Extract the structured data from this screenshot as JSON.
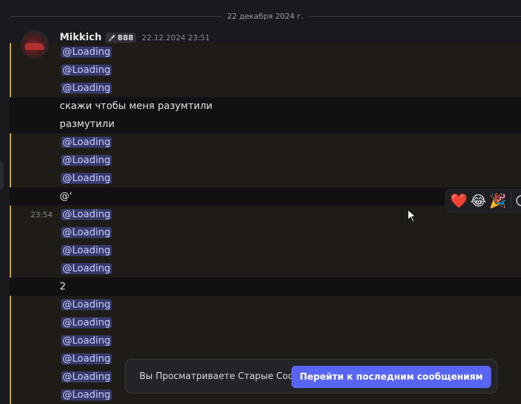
{
  "divider": {
    "date": "22 декабря 2024 г."
  },
  "message": {
    "author": "Mikkich",
    "badge": "888",
    "timestamp": "22.12.2024 23:51"
  },
  "rows": [
    {
      "type": "mention",
      "text": "@Loading",
      "hl": true
    },
    {
      "type": "mention",
      "text": "@Loading",
      "hl": true
    },
    {
      "type": "mention",
      "text": "@Loading",
      "hl": true
    },
    {
      "type": "text",
      "text": "скажи чтобы меня разумтили",
      "hl": false
    },
    {
      "type": "text",
      "text": "размутили",
      "hl": false
    },
    {
      "type": "mention",
      "text": "@Loading",
      "hl": true
    },
    {
      "type": "mention",
      "text": "@Loading",
      "hl": true
    },
    {
      "type": "mention",
      "text": "@Loading",
      "hl": true
    },
    {
      "type": "text",
      "text": "@'",
      "hl": false
    },
    {
      "type": "mention",
      "text": "@Loading",
      "hl": true,
      "hover_time": "23:54"
    },
    {
      "type": "mention",
      "text": "@Loading",
      "hl": true
    },
    {
      "type": "mention",
      "text": "@Loading",
      "hl": true
    },
    {
      "type": "mention",
      "text": "@Loading",
      "hl": true
    },
    {
      "type": "text",
      "text": "2",
      "hl": false
    },
    {
      "type": "mention",
      "text": "@Loading",
      "hl": true
    },
    {
      "type": "mention",
      "text": "@Loading",
      "hl": true
    },
    {
      "type": "mention",
      "text": "@Loading",
      "hl": true
    },
    {
      "type": "mention",
      "text": "@Loading",
      "hl": true
    },
    {
      "type": "mention",
      "text": "@Loading",
      "hl": true
    },
    {
      "type": "mention",
      "text": "@Loading",
      "hl": true
    }
  ],
  "reactions": [
    "❤️",
    "😂",
    "🎉"
  ],
  "banner": {
    "text": "Вы Просматриваете Старые Сообщения",
    "button": "Перейти к последним сообщениям"
  },
  "colors": {
    "accent": "#5865f2",
    "highlight_border": "#c9a24a",
    "mention_bg": "#363a6b"
  }
}
